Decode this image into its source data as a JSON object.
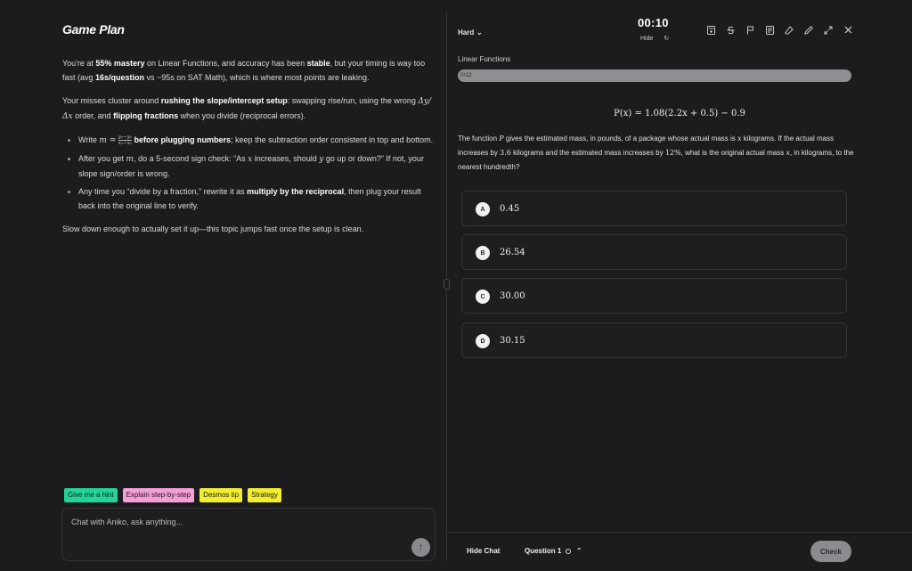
{
  "left": {
    "title": "Game Plan",
    "p1": {
      "a": "You're at ",
      "b": "55% mastery",
      "c": " on Linear Functions, and accuracy has been ",
      "d": "stable",
      "e": ", but your timing is way too fast (avg ",
      "f": "16s/question",
      "g": " vs ~95s on SAT Math), which is where most points are leaking."
    },
    "p2": {
      "a": "Your misses cluster around ",
      "b": "rushing the slope/intercept setup",
      "c": ": swapping rise/run, using the wrong ",
      "d": "Δy/Δx",
      "e": " order, and ",
      "f": "flipping fractions",
      "g": " when you divide (reciprocal errors)."
    },
    "bullet1": {
      "a": "Write ",
      "m": "m =",
      "num": "y₂−y₁",
      "den": "x₂−x₁",
      "b": " before plugging numbers",
      "c": "; keep the subtraction order consistent in top and bottom."
    },
    "bullet2": {
      "a": "After you get ",
      "m": "m",
      "b": ", do a 5-second sign check: “As ",
      "x": "x",
      "c": " increases, should ",
      "y": "y",
      "d": " go up or down?” If not, your slope sign/order is wrong."
    },
    "bullet3": {
      "a": "Any time you “divide by a fraction,” rewrite it as ",
      "b": "multiply by the reciprocal",
      "c": ", then plug your result back into the original line to verify."
    },
    "p3": "Slow down enough to actually set it up—this topic jumps fast once the setup is clean.",
    "chips": [
      "Give me a hint",
      "Explain step-by-step",
      "Desmos tip",
      "Strategy"
    ],
    "chat_placeholder": "Chat with Aniko, ask anything...",
    "send_icon": "↑"
  },
  "right": {
    "difficulty": "Hard",
    "timer": "00:10",
    "hide_label": "Hide",
    "topic": "Linear Functions",
    "progress_text": "0/12",
    "progress_fraction": 0,
    "formula": "P(x) = 1.08(2.2x + 0.5) − 0.9",
    "question": {
      "a": "The function ",
      "P": "P",
      "b": " gives the estimated mass, in pounds, of a package whose actual mass is ",
      "x1": "x",
      "c": " kilograms. If the actual mass increases by ",
      "n1": "3.6",
      "d": " kilograms and the estimated mass increases by ",
      "n2": "12%",
      "e": ", what is the original actual mass ",
      "x2": "x",
      "f": ", in kilograms, to the nearest hundredth?"
    },
    "choices": [
      {
        "letter": "A",
        "value": "0.45"
      },
      {
        "letter": "B",
        "value": "26.54"
      },
      {
        "letter": "C",
        "value": "30.00"
      },
      {
        "letter": "D",
        "value": "30.15"
      }
    ],
    "hide_chat": "Hide Chat",
    "question_nav": "Question 1",
    "check": "Check"
  },
  "icons": {
    "chevron": "⌄",
    "refresh": "↻",
    "tools": [
      "calculator-icon",
      "strikethrough-icon",
      "flag-icon",
      "reference-sheet-icon",
      "eraser-icon",
      "pen-icon",
      "expand-icon",
      "close-icon"
    ]
  }
}
